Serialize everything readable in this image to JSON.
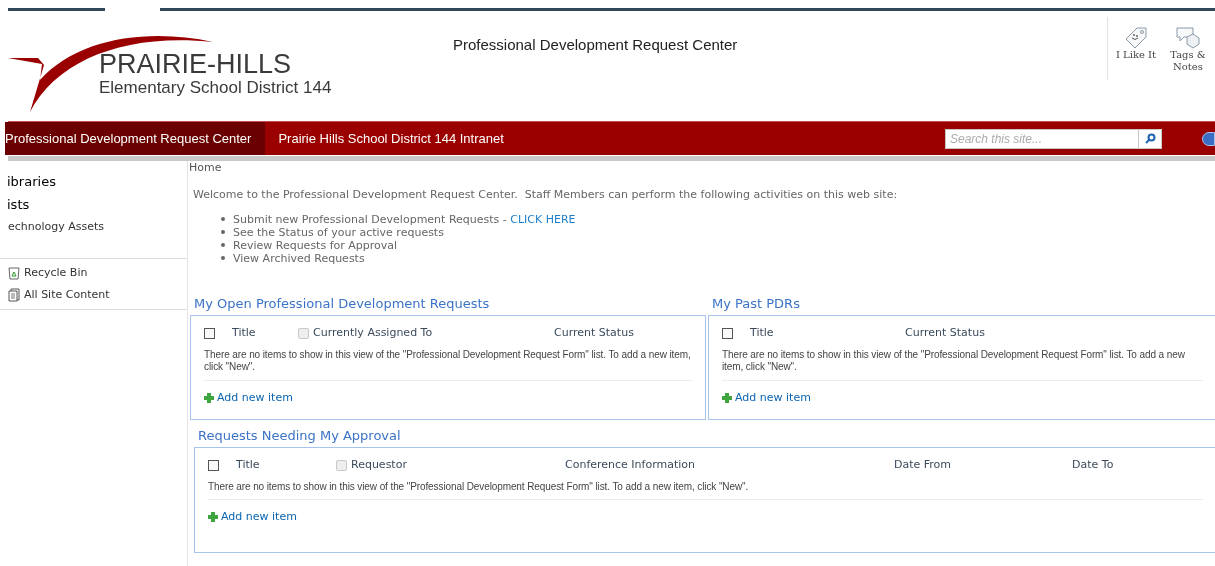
{
  "header": {
    "logo_title": "PRAIRIE-HILLS",
    "logo_subtitle": "Elementary School District 144",
    "site_title": "Professional Development Request Center",
    "actions": [
      {
        "kind": "like",
        "label": "I Like It"
      },
      {
        "kind": "tags",
        "label": "Tags & Notes"
      }
    ]
  },
  "top_nav": {
    "tabs": [
      {
        "label": "Professional Development Request Center",
        "selected": true
      },
      {
        "label": "Prairie Hills School District 144 Intranet",
        "selected": false
      }
    ],
    "search": {
      "placeholder": "Search this site..."
    }
  },
  "sidebar": {
    "headings": [
      "ibraries",
      "ists"
    ],
    "items": [
      "echnology Assets"
    ],
    "footer_links": [
      {
        "kind": "recycle",
        "label": "Recycle Bin"
      },
      {
        "kind": "content",
        "label": "All Site Content"
      }
    ]
  },
  "breadcrumb": "Home",
  "welcome": {
    "text": "Welcome to the Professional Development Request Center.  Staff Members can perform the following activities on this web site:",
    "bullets": [
      {
        "text": "Submit new Professional Development Requests - ",
        "link": "CLICK HERE"
      },
      {
        "text": "See the Status of your active requests"
      },
      {
        "text": "Review Requests for Approval"
      },
      {
        "text": "View Archived Requests"
      }
    ]
  },
  "web_parts": [
    {
      "title": "My Open Professional Development Requests",
      "select_all_checked": false,
      "columns": [
        {
          "label": "Title",
          "kind": "text"
        },
        {
          "label": "Currently Assigned To",
          "kind": "person"
        },
        {
          "label": "Current Status",
          "kind": "text"
        }
      ],
      "empty_message": "There are no items to show in this view of the \"Professional Development Request Form\" list. To add a new item, click \"New\".",
      "add_link": "Add new item"
    },
    {
      "title": "My Past PDRs",
      "select_all_checked": false,
      "columns": [
        {
          "label": "Title",
          "kind": "text"
        },
        {
          "label": "Current Status",
          "kind": "text"
        }
      ],
      "empty_message": "There are no items to show in this view of the \"Professional Development Request Form\" list. To add a new item, click \"New\".",
      "add_link": "Add new item"
    },
    {
      "title": "Requests Needing My Approval",
      "select_all_checked": false,
      "columns": [
        {
          "label": "Title",
          "kind": "text"
        },
        {
          "label": "Requestor",
          "kind": "person"
        },
        {
          "label": "Conference Information",
          "kind": "text"
        },
        {
          "label": "Date From",
          "kind": "text"
        },
        {
          "label": "Date To",
          "kind": "text"
        }
      ],
      "empty_message": "There are no items to show in this view of the \"Professional Development Request Form\" list. To add a new item, click \"New\".",
      "add_link": "Add new item"
    }
  ]
}
